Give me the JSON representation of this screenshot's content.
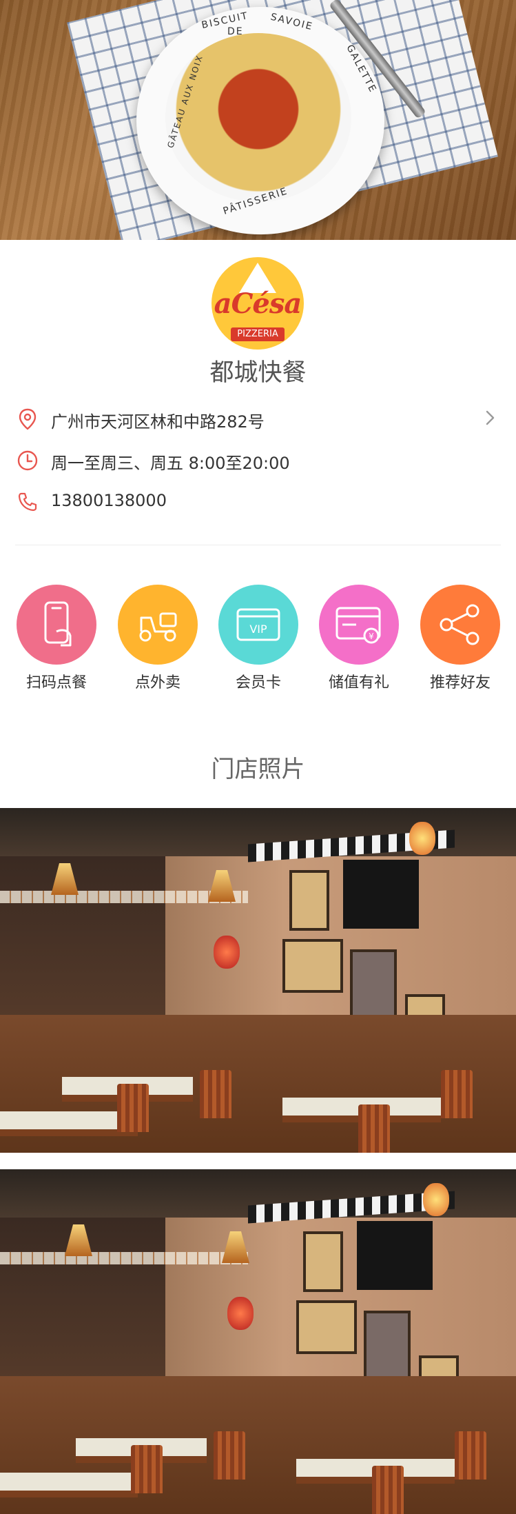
{
  "hero": {
    "plate_text": [
      "BISCUIT",
      "DE",
      "SAVOIE",
      "GALETTE",
      "PÂTISSERIE",
      "GÂTEAU AUX NOIX"
    ]
  },
  "store": {
    "logo_text": "aCésa",
    "logo_subtext": "PIZZERIA",
    "name": "都城快餐",
    "address": "广州市天河区林和中路282号",
    "hours": "周一至周三、周五 8:00至20:00",
    "phone": "13800138000"
  },
  "features": [
    {
      "label": "扫码点餐",
      "icon": "phone-scan-icon",
      "color": "#f06e8a"
    },
    {
      "label": "点外卖",
      "icon": "scooter-icon",
      "color": "#ffb42e"
    },
    {
      "label": "会员卡",
      "icon": "vip-card-icon",
      "color": "#5ad9d6"
    },
    {
      "label": "储值有礼",
      "icon": "gift-card-icon",
      "color": "#f46fc8"
    },
    {
      "label": "推荐好友",
      "icon": "share-icon",
      "color": "#ff7b3a"
    }
  ],
  "vip_text": "VIP",
  "yen_text": "¥",
  "photos_section": {
    "title": "门店照片"
  },
  "colors": {
    "accent_red": "#e8564f",
    "text": "#333333"
  }
}
